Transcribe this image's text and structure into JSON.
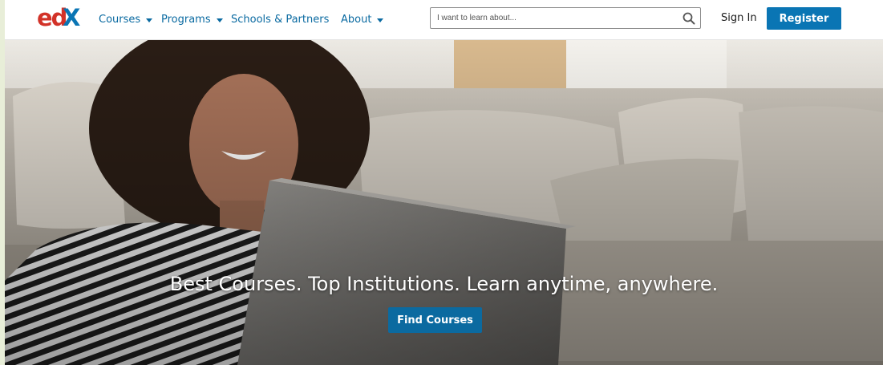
{
  "brand": {
    "logo_text": "edX"
  },
  "nav": {
    "items": [
      {
        "label": "Courses",
        "has_dropdown": true
      },
      {
        "label": "Programs",
        "has_dropdown": true
      },
      {
        "label": "Schools & Partners",
        "has_dropdown": false
      },
      {
        "label": "About",
        "has_dropdown": true
      }
    ]
  },
  "search": {
    "placeholder": "I want to learn about...",
    "value": "",
    "icon": "search-icon"
  },
  "auth": {
    "signin_label": "Sign In",
    "register_label": "Register"
  },
  "hero": {
    "tagline": "Best Courses. Top Institutions. Learn anytime, anywhere.",
    "cta_label": "Find Courses"
  },
  "colors": {
    "accent": "#0a75b4",
    "logo_red": "#d23228",
    "logo_blue": "#0a75b4",
    "nav_text": "#0a6aa1"
  }
}
